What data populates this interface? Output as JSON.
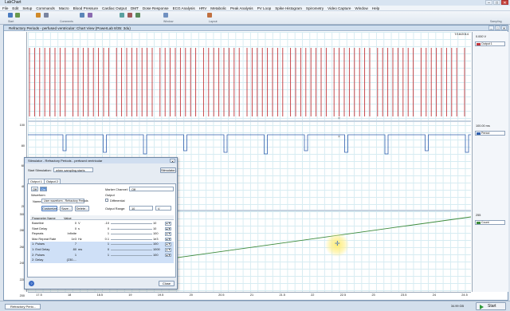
{
  "app": {
    "title": "LabChart"
  },
  "menu": [
    "File",
    "Edit",
    "Setup",
    "Commands",
    "Macro",
    "Blood Pressure",
    "Cardiac Output",
    "DMT",
    "Dose Response",
    "ECG Analysis",
    "HRV",
    "Metabolic",
    "Peak Analysis",
    "PV Loop",
    "Spike Histogram",
    "Spirometry",
    "Video Capture",
    "Window",
    "Help"
  ],
  "toolbar": {
    "groups": [
      "Start",
      "Comments",
      "Window",
      "Layout"
    ],
    "right_label": "Sampling"
  },
  "document": {
    "title": "Refractory Periods - perfused ventricular: Chart View (PowerLab 8/35: 3du)",
    "date": "7/16/2014"
  },
  "channels": [
    {
      "name": "Output 1",
      "value": "0.000 V",
      "color": "#c0353a",
      "yticks": []
    },
    {
      "name": "Period",
      "value": "100.00 ms",
      "color": "#2f5fae",
      "yticks": [
        "100",
        "80",
        "60",
        "40",
        "20"
      ]
    },
    {
      "name": "Count",
      "value": "255",
      "color": "#3c8a3a",
      "yticks": [
        "300",
        "280",
        "260",
        "240",
        "220",
        "200"
      ]
    }
  ],
  "xaxis": {
    "ticks": [
      "17.5",
      "18",
      "18.5",
      "19",
      "19.5",
      "20",
      "20.5",
      "21",
      "21.5",
      "22",
      "22.5",
      "23",
      "23.5",
      "24",
      "24.5"
    ],
    "unit_label": "23.615 s"
  },
  "status": {
    "tab_label": "Refractory Perio...",
    "disk": "34.99 GB",
    "start_label": "Start"
  },
  "dialog": {
    "title": "Stimulator - Refractory Periods - perfused ventricular",
    "start_stimulation_label": "Start Stimulation:",
    "start_stimulation_value": "when sampling starts",
    "stimulator_button": "Stimulator...",
    "tabs": [
      "Output 1",
      "Output 2"
    ],
    "off_label": "Off",
    "on_label": "On",
    "waveform_label": "Waveform",
    "name_label": "Name:",
    "name_value": "User waveform - Refractory Periods",
    "buttons": [
      "Customize...",
      "Save...",
      "Delete..."
    ],
    "marker_channel_label": "Marker Channel:",
    "marker_channel_value": "Off",
    "differential_label": "Differential",
    "output_label": "Output",
    "output_range_label": "Output Range:",
    "output_range_value": "10",
    "output_range_unit": "V",
    "table_headers": [
      "Parameter Name",
      "Value"
    ],
    "params": [
      {
        "name": "Baseline",
        "value": "0",
        "unit": "V",
        "min": "-10",
        "max": "10",
        "highlight": false
      },
      {
        "name": "Start Delay",
        "value": "0",
        "unit": "s",
        "min": "0",
        "max": "10",
        "highlight": false
      },
      {
        "name": "Repeats",
        "value": "Infinite",
        "unit": "",
        "min": "1",
        "max": "100",
        "highlight": false
      },
      {
        "name": "Max Repeat Rate",
        "value": "1e3",
        "unit": "Hz",
        "min": "0.1",
        "max": "1e3",
        "highlight": false
      },
      {
        "name": "1: Pulses",
        "value": "7",
        "unit": "",
        "min": "1",
        "max": "100",
        "highlight": true
      },
      {
        "name": "1: End Delay",
        "value": "80",
        "unit": "ms",
        "min": "0",
        "max": "1000",
        "highlight": true
      },
      {
        "name": "2: Pulses",
        "value": "1",
        "unit": "",
        "min": "1",
        "max": "100",
        "highlight": true
      },
      {
        "name": "2: Delay",
        "value": "(230-...",
        "unit": "",
        "min": "",
        "max": "",
        "highlight": true
      }
    ],
    "close_label": "Close"
  }
}
